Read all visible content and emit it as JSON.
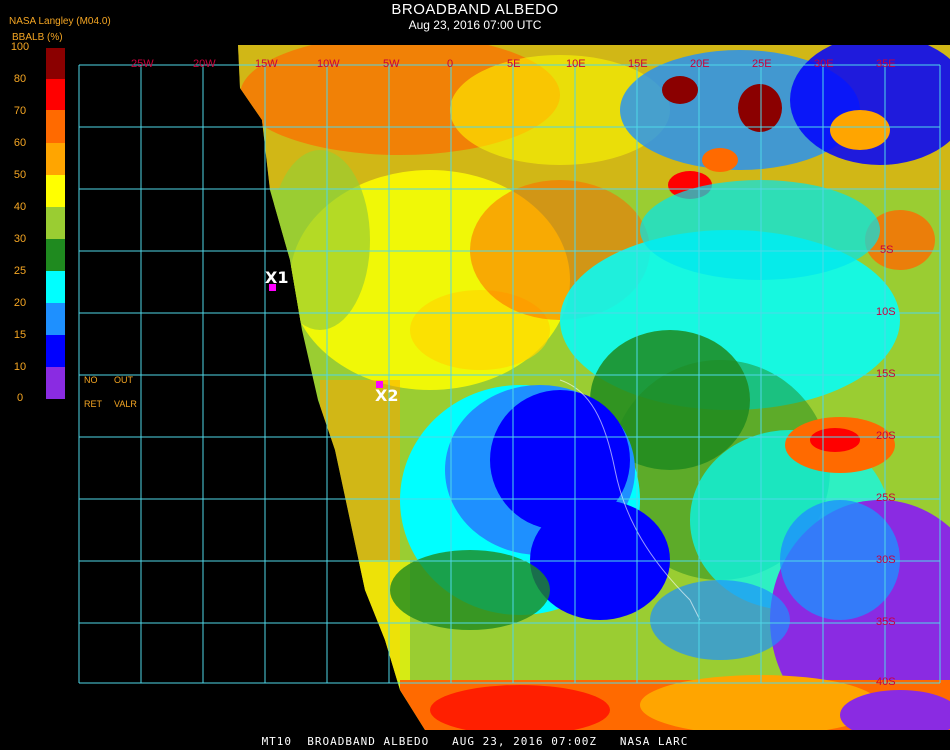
{
  "header": {
    "title": "BROADBAND ALBEDO",
    "subtitle": "Aug 23, 2016 07:00 UTC",
    "provider": "NASA Langley (M04.0)",
    "parameter": "BBALB (%)"
  },
  "legend": {
    "ticks": [
      "100",
      "80",
      "70",
      "60",
      "50",
      "40",
      "30",
      "25",
      "20",
      "15",
      "10",
      "0"
    ],
    "colors": [
      "#8b0000",
      "#ff0000",
      "#ff6a00",
      "#ffa500",
      "#ffff00",
      "#9acd32",
      "#1f8a1f",
      "#00ffff",
      "#1e90ff",
      "#0000ff",
      "#8a2be2"
    ],
    "notes": {
      "no_label": "NO",
      "out_label": "OUT",
      "ret_label": "RET",
      "valr_label": "VALR"
    }
  },
  "grid": {
    "top_labels": [
      "25W",
      "20W",
      "15W",
      "10W",
      "5W",
      "0",
      "5E",
      "10E",
      "15E",
      "20E",
      "25E",
      "30E",
      "35E"
    ],
    "right_labels": [
      "5S",
      "10S",
      "15S",
      "20S",
      "25S",
      "30S",
      "35S",
      "40S"
    ]
  },
  "markers": [
    {
      "id": "X1",
      "label": "X1"
    },
    {
      "id": "X2",
      "label": "X2"
    }
  ],
  "footer": {
    "text": "MT10  BROADBAND ALBEDO   AUG 23, 2016 07:00Z   NASA LARC"
  },
  "colors": {
    "grid": "#4fd8e8",
    "marker": "#ff00ff",
    "label_orange": "#f5a623",
    "grid_label": "#c8003c"
  }
}
